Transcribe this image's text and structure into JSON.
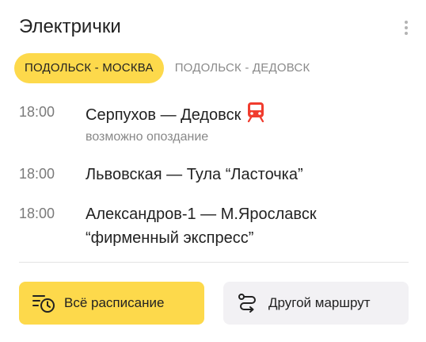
{
  "widget": {
    "title": "Электрички",
    "menu_icon": "more-vertical-icon"
  },
  "tabs": [
    {
      "label": "ПОДОЛЬСК - МОСКВА",
      "active": true
    },
    {
      "label": "ПОДОЛЬСК - ДЕДОВСК",
      "active": false
    }
  ],
  "trains": [
    {
      "time": "18:00",
      "route": "Серпухов — Дедовск",
      "icon": "train-icon",
      "icon_color": "#f03c2e",
      "note": "возможно опоздание"
    },
    {
      "time": "18:00",
      "route": "Львовская — Тула “Ласточка”"
    },
    {
      "time": "18:00",
      "route_line1": "Александров-1 — М.Ярославск",
      "route_line2": "“фирменный экспресс”"
    }
  ],
  "buttons": {
    "schedule": {
      "label": "Всё расписание",
      "icon": "schedule-clock-icon",
      "bg": "#fdd94b"
    },
    "other_route": {
      "label": "Другой маршрут",
      "icon": "route-icon",
      "bg": "#f2f1f4"
    }
  }
}
